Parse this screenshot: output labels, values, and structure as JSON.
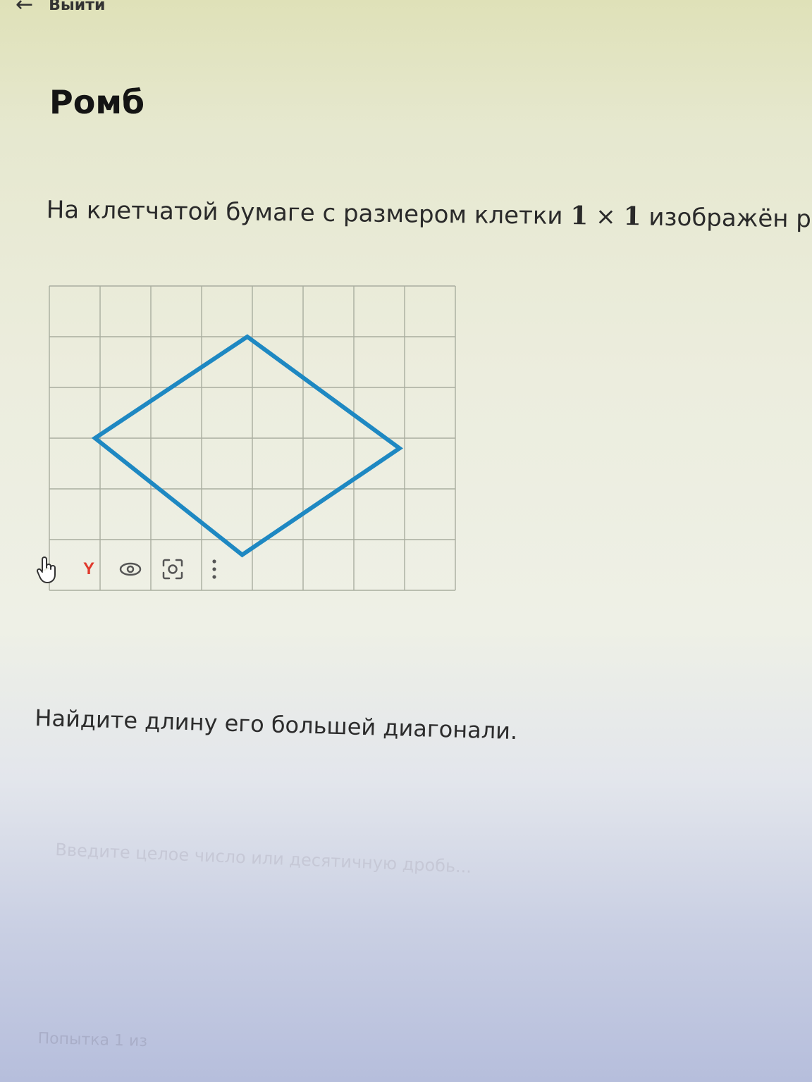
{
  "nav": {
    "back_label": "Выйти",
    "back_icon": "arrow-left-icon"
  },
  "title": "Ромб",
  "task": {
    "text_before": "На клетчатой бумаге с размером клетки ",
    "n1": "1",
    "times": " × ",
    "n2": "1",
    "text_after": " изображён р"
  },
  "figure": {
    "grid_columns": 8,
    "grid_rows": 6,
    "grid_color": "#a9ad9f",
    "rhombus_color": "#1e88c2",
    "rhombus_vertices": [
      [
        3.9,
        1.0
      ],
      [
        6.9,
        3.2
      ],
      [
        3.8,
        5.3
      ],
      [
        0.9,
        3.0
      ]
    ]
  },
  "toolbar": {
    "items": [
      {
        "icon": "hand-cursor-icon"
      },
      {
        "icon": "yandex-logo-icon",
        "glyph": "Y"
      },
      {
        "icon": "eye-icon"
      },
      {
        "icon": "lens-scan-icon"
      },
      {
        "icon": "more-vertical-icon"
      }
    ]
  },
  "question": "Найдите длину его большей диагонали.",
  "answer": {
    "placeholder": "Введите целое число или десятичную дробь...",
    "value": ""
  },
  "attempt": "Попытка 1 из"
}
